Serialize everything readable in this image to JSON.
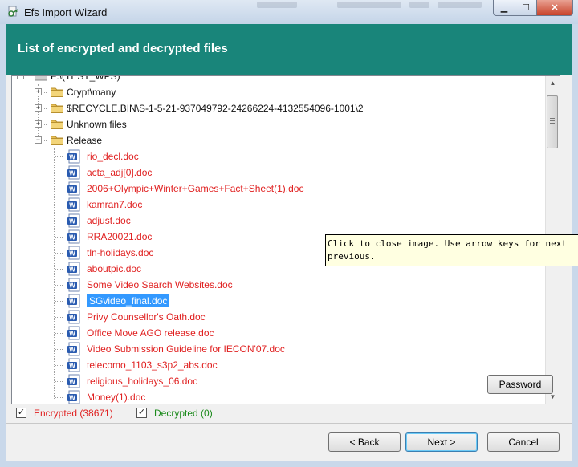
{
  "window": {
    "title": "Efs Import Wizard",
    "buttons": {
      "minimize": "▁",
      "maximize": "☐",
      "close": "✕"
    }
  },
  "header": {
    "title": "List of encrypted and decrypted files"
  },
  "tree": {
    "top_partial_label": "F:\\(TEST_WPS)",
    "folders": [
      {
        "label": "Crypt\\many",
        "expander": "+"
      },
      {
        "label": "$RECYCLE.BIN\\S-1-5-21-937049792-24266224-4132554096-1001\\2",
        "expander": "+"
      },
      {
        "label": "Unknown files",
        "expander": "+"
      },
      {
        "label": "Release",
        "expander": "−"
      }
    ],
    "files": [
      {
        "label": "rio_decl.doc",
        "selected": false
      },
      {
        "label": "acta_adj[0].doc",
        "selected": false
      },
      {
        "label": "2006+Olympic+Winter+Games+Fact+Sheet(1).doc",
        "selected": false
      },
      {
        "label": "kamran7.doc",
        "selected": false
      },
      {
        "label": "adjust.doc",
        "selected": false
      },
      {
        "label": "RRA20021.doc",
        "selected": false
      },
      {
        "label": "tln-holidays.doc",
        "selected": false
      },
      {
        "label": "aboutpic.doc",
        "selected": false
      },
      {
        "label": "Some Video Search Websites.doc",
        "selected": false
      },
      {
        "label": "SGvideo_final.doc",
        "selected": true
      },
      {
        "label": "Privy Counsellor's Oath.doc",
        "selected": false
      },
      {
        "label": "Office Move AGO release.doc",
        "selected": false
      },
      {
        "label": "Video Submission Guideline for IECON'07.doc",
        "selected": false
      },
      {
        "label": "telecomo_1103_s3p2_abs.doc",
        "selected": false
      },
      {
        "label": "religious_holidays_06.doc",
        "selected": false
      },
      {
        "label": "Money(1).doc",
        "selected": false
      }
    ],
    "file_icon_glyph": "W",
    "colors": {
      "encrypted": "#e02020",
      "decrypted": "#1a8a1a",
      "selection": "#3399ff",
      "header": "#19857a"
    }
  },
  "tooltip": {
    "line1": "Click to close image. Use arrow keys for next",
    "line2": "previous."
  },
  "password_button": "Password",
  "status": {
    "encrypted_check": "✓",
    "encrypted_label": "Encrypted (38671)",
    "decrypted_check": "✓",
    "decrypted_label": "Decrypted (0)"
  },
  "nav": {
    "back": "< Back",
    "next": "Next >",
    "cancel": "Cancel"
  },
  "scrollbar": {
    "up": "▲",
    "down": "▼"
  }
}
